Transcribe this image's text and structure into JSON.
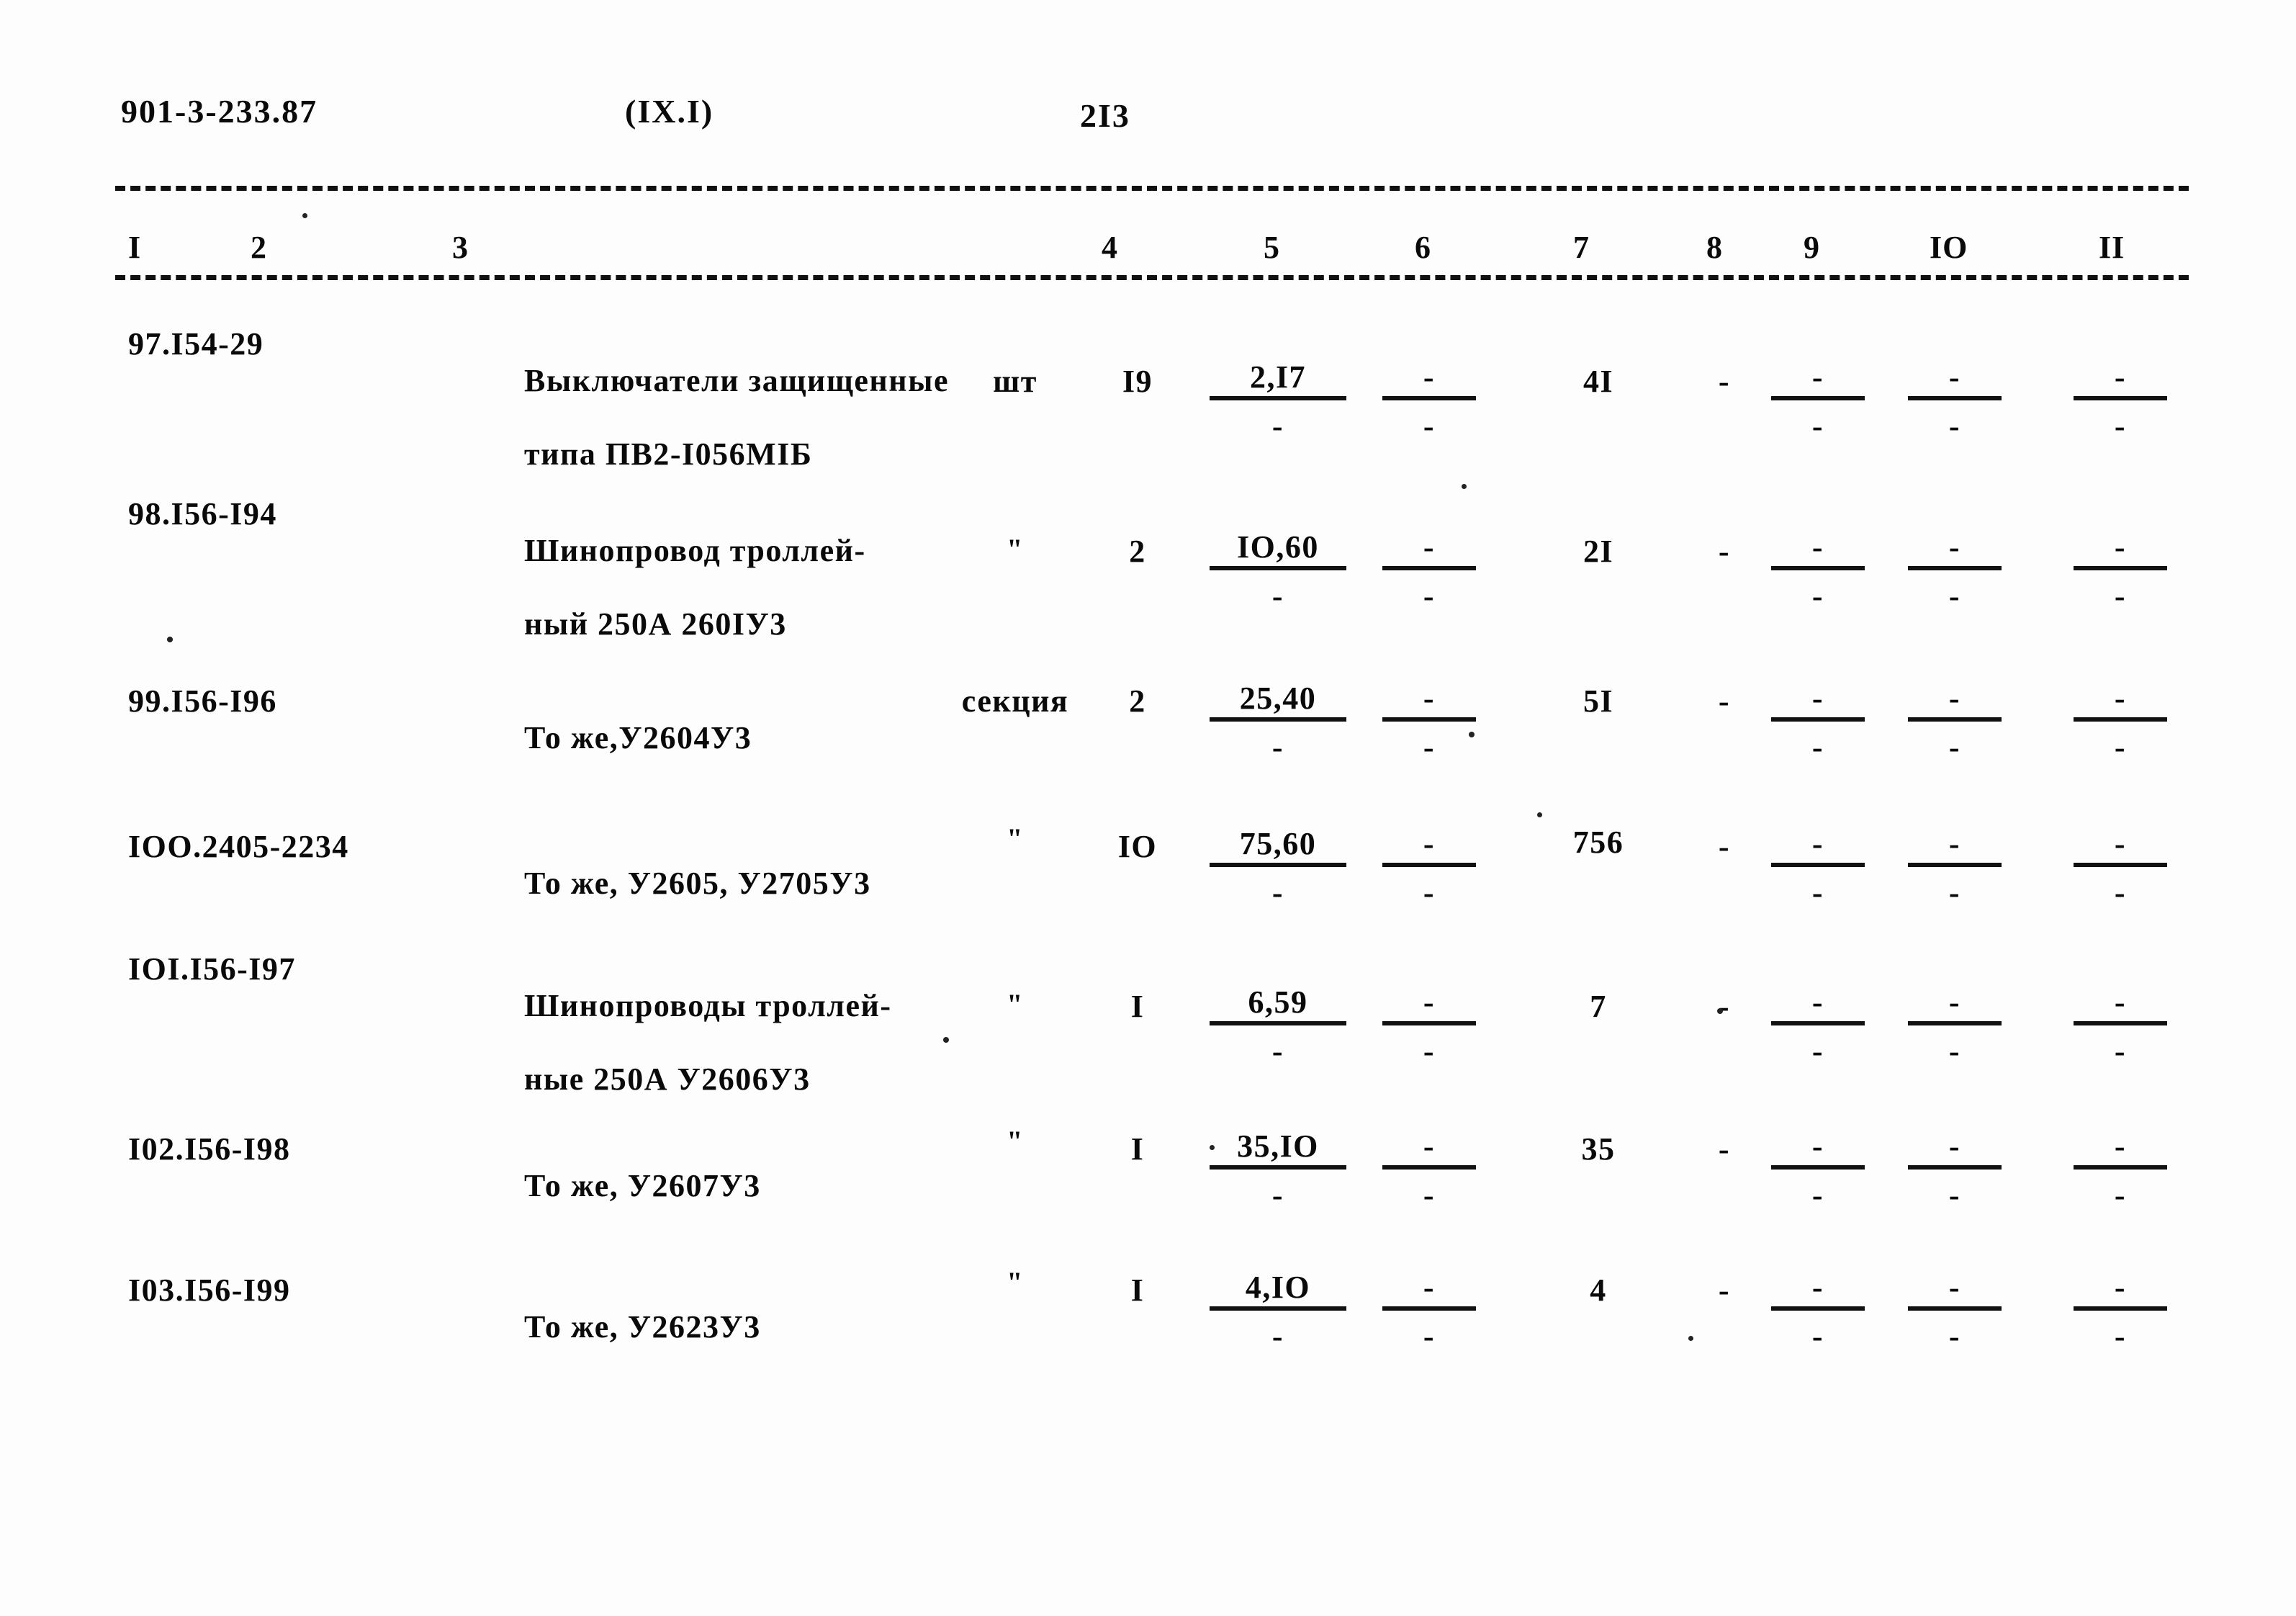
{
  "document": {
    "code": "901-3-233.87",
    "section": "(IX.I)",
    "page_number": "2I3"
  },
  "table": {
    "column_headers": [
      "I",
      "2",
      "3",
      "4",
      "5",
      "6",
      "7",
      "8",
      "9",
      "IO",
      "II"
    ],
    "rows": [
      {
        "code": "97.I54-29",
        "name_line1": "Выключатели защищенные",
        "name_line2": "типа ПВ2-I056МIБ",
        "unit": "шт",
        "qty": "I9",
        "c5_num": "2,I7",
        "c5_den": "-",
        "c6_num": "-",
        "c6_den": "-",
        "c7": "4I",
        "c8": "-",
        "c9_num": "-",
        "c9_den": "-",
        "c10_num": "-",
        "c10_den": "-",
        "c11_num": "-",
        "c11_den": "-"
      },
      {
        "code": "98.I56-I94",
        "name_line1": "Шинопровод троллей-",
        "name_line2": "ный 250А 260IУ3",
        "unit": "\"",
        "qty": "2",
        "c5_num": "IO,60",
        "c5_den": "-",
        "c6_num": "-",
        "c6_den": "-",
        "c7": "2I",
        "c8": "-",
        "c9_num": "-",
        "c9_den": "-",
        "c10_num": "-",
        "c10_den": "-",
        "c11_num": "-",
        "c11_den": "-"
      },
      {
        "code": "99.I56-I96",
        "name_line1": "То же,У2604У3",
        "name_line2": "",
        "unit": "секция",
        "qty": "2",
        "c5_num": "25,40",
        "c5_den": "-",
        "c6_num": "-",
        "c6_den": "-",
        "c7": "5I",
        "c8": "-",
        "c9_num": "-",
        "c9_den": "-",
        "c10_num": "-",
        "c10_den": "-",
        "c11_num": "-",
        "c11_den": "-"
      },
      {
        "code": "IOO.2405-2234",
        "name_line1": "То же, У2605, У2705У3",
        "name_line2": "",
        "unit": "\"",
        "qty": "IO",
        "c5_num": "75,60",
        "c5_den": "-",
        "c6_num": "-",
        "c6_den": "-",
        "c7": "756",
        "c8": "-",
        "c9_num": "-",
        "c9_den": "-",
        "c10_num": "-",
        "c10_den": "-",
        "c11_num": "-",
        "c11_den": "-"
      },
      {
        "code": "IOI.I56-I97",
        "name_line1": "Шинопроводы троллей-",
        "name_line2": "ные 250А У2606У3",
        "unit": "\"",
        "qty": "I",
        "c5_num": "6,59",
        "c5_den": "-",
        "c6_num": "-",
        "c6_den": "-",
        "c7": "7",
        "c8": "-",
        "c9_num": "-",
        "c9_den": "-",
        "c10_num": "-",
        "c10_den": "-",
        "c11_num": "-",
        "c11_den": "-"
      },
      {
        "code": "I02.I56-I98",
        "name_line1": "То же, У2607У3",
        "name_line2": "",
        "unit": "\"",
        "qty": "I",
        "c5_num": "35,IO",
        "c5_den": "-",
        "c6_num": "-",
        "c6_den": "-",
        "c7": "35",
        "c8": "-",
        "c9_num": "-",
        "c9_den": "-",
        "c10_num": "-",
        "c10_den": "-",
        "c11_num": "-",
        "c11_den": "-"
      },
      {
        "code": "I03.I56-I99",
        "name_line1": "То же, У2623У3",
        "name_line2": "",
        "unit": "\"",
        "qty": "I",
        "c5_num": "4,IO",
        "c5_den": "-",
        "c6_num": "-",
        "c6_den": "-",
        "c7": "4",
        "c8": "-",
        "c9_num": "-",
        "c9_den": "-",
        "c10_num": "-",
        "c10_den": "-",
        "c11_num": "-",
        "c11_den": "-"
      }
    ]
  }
}
